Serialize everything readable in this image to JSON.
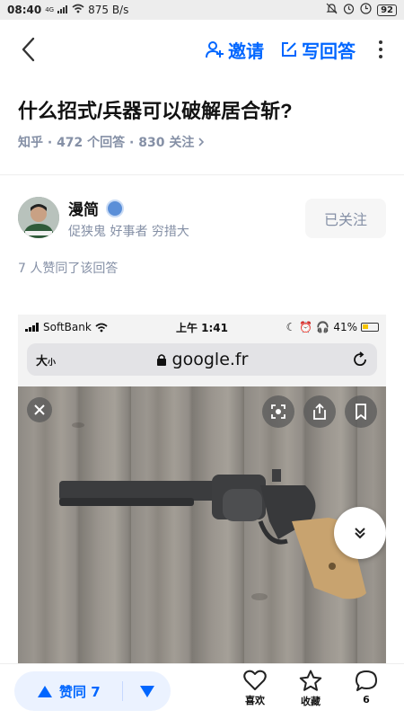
{
  "status_bar": {
    "time": "08:40",
    "network_badge": "4G",
    "speed": "875 B/s",
    "battery": "92"
  },
  "nav": {
    "invite_label": "邀请",
    "write_answer_label": "写回答",
    "accent_color": "#0066ff"
  },
  "question": {
    "title": "什么招式/兵器可以破解居合斩?",
    "meta": "知乎 · 472 个回答 · 830 关注"
  },
  "author": {
    "name": "漫简",
    "bio": "促狭鬼 好事者 穷措大",
    "follow_label": "已关注",
    "voted_text": "7 人赞同了该回答"
  },
  "embedded_screenshot": {
    "carrier": "SoftBank",
    "time": "上午 1:41",
    "battery": "41%",
    "size_label": "大",
    "size_label_small": "小",
    "url": "google.fr"
  },
  "bottom_bar": {
    "vote_label": "赞同 7",
    "like_label": "喜欢",
    "favorite_label": "收藏",
    "comment_count": "6"
  }
}
